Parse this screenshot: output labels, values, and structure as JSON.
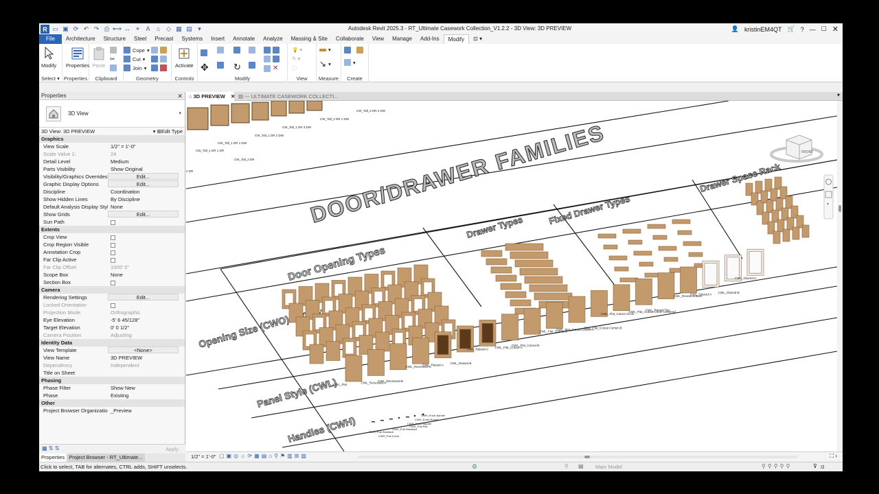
{
  "window": {
    "title": "Autodesk Revit 2025.3 - RT_Ultimate Casework Collection_V1.2.2 - 3D View: 3D PREVIEW",
    "user": "kristinEM4QT",
    "help": "?"
  },
  "ribbon_tabs": [
    "File",
    "Architecture",
    "Structure",
    "Steel",
    "Precast",
    "Systems",
    "Insert",
    "Annotate",
    "Analyze",
    "Massing & Site",
    "Collaborate",
    "View",
    "Manage",
    "Add-Ins",
    "Modify"
  ],
  "ribbon": {
    "select": {
      "modify": "Modify",
      "label": "Select"
    },
    "properties": {
      "button": "Properties",
      "label": "Properties"
    },
    "clipboard": {
      "paste": "Paste",
      "cope": "Cope",
      "cut": "Cut",
      "join": "Join",
      "label": "Clipboard"
    },
    "geometry": {
      "label": "Geometry"
    },
    "controls": {
      "activate": "Activate",
      "label": "Controls"
    },
    "modify": {
      "label": "Modify"
    },
    "view": {
      "label": "View"
    },
    "measure": {
      "label": "Measure"
    },
    "create": {
      "label": "Create"
    }
  },
  "properties": {
    "header": "Properties",
    "type_name": "3D View",
    "instance": "3D View: 3D PREVIEW",
    "edit_type": "Edit Type",
    "apply": "Apply",
    "groups": [
      {
        "name": "Graphics",
        "rows": [
          {
            "n": "View Scale",
            "v": "1/2\" = 1'-0\""
          },
          {
            "n": "Scale Value    1:",
            "v": "24",
            "dim": true
          },
          {
            "n": "Detail Level",
            "v": "Medium"
          },
          {
            "n": "Parts Visibility",
            "v": "Show Original"
          },
          {
            "n": "Visibility/Graphics Overrides",
            "v": "Edit...",
            "btn": true
          },
          {
            "n": "Graphic Display Options",
            "v": "Edit...",
            "btn": true
          },
          {
            "n": "Discipline",
            "v": "Coordination"
          },
          {
            "n": "Show Hidden Lines",
            "v": "By Discipline"
          },
          {
            "n": "Default Analysis Display Style",
            "v": "None"
          },
          {
            "n": "Show Grids",
            "v": "Edit...",
            "btn": true
          },
          {
            "n": "Sun Path",
            "v": "",
            "cb": true
          }
        ]
      },
      {
        "name": "Extents",
        "rows": [
          {
            "n": "Crop View",
            "v": "",
            "cb": true
          },
          {
            "n": "Crop Region Visible",
            "v": "",
            "cb": true
          },
          {
            "n": "Annotation Crop",
            "v": "",
            "cb": true
          },
          {
            "n": "Far Clip Active",
            "v": "",
            "cb": true
          },
          {
            "n": "Far Clip Offset",
            "v": "1000'  0\"",
            "dim": true
          },
          {
            "n": "Scope Box",
            "v": "None"
          },
          {
            "n": "Section Box",
            "v": "",
            "cb": true
          }
        ]
      },
      {
        "name": "Camera",
        "rows": [
          {
            "n": "Rendering Settings",
            "v": "Edit...",
            "btn": true
          },
          {
            "n": "Locked Orientation",
            "v": "",
            "cb": true,
            "dim": true
          },
          {
            "n": "Projection Mode",
            "v": "Orthographic",
            "dim": true
          },
          {
            "n": "Eye Elevation",
            "v": "-5'  6 45/128\""
          },
          {
            "n": "Target Elevation",
            "v": "0'  0 1/2\""
          },
          {
            "n": "Camera Position",
            "v": "Adjusting",
            "dim": true
          }
        ]
      },
      {
        "name": "Identity Data",
        "rows": [
          {
            "n": "View Template",
            "v": "<None>",
            "btn": true
          },
          {
            "n": "View Name",
            "v": "3D PREVIEW"
          },
          {
            "n": "Dependency",
            "v": "Independent",
            "dim": true
          },
          {
            "n": "Title on Sheet",
            "v": ""
          }
        ]
      },
      {
        "name": "Phasing",
        "rows": [
          {
            "n": "Phase Filter",
            "v": "Show New"
          },
          {
            "n": "Phase",
            "v": "Existing"
          }
        ]
      },
      {
        "name": "Other",
        "rows": [
          {
            "n": "Project Browser Organization",
            "v": "_Preview"
          }
        ]
      }
    ],
    "tabs": [
      "Properties",
      "Project Browser - RT_Ultimate..."
    ]
  },
  "view_tabs": [
    {
      "label": "3D PREVIEW",
      "active": true
    },
    {
      "label": "--- ULTIMATE CASEWORK COLLECTI...",
      "active": false
    }
  ],
  "viewport": {
    "heading": "DOOR/DRAWER FAMILIES",
    "sections": [
      "Door Opening Types",
      "Drawer Types",
      "Fixed Drawer Types",
      "Drawer Space Rack",
      "Opening Size (CWO) Type 1-5",
      "Panel Style (CWL)",
      "Handles (CWH)"
    ],
    "tall_labels": [
      "CW_Tall_1 DR 1 DR",
      "CW_Tall_1 DR 1 DW",
      "CW_Tall_1 DR 2 DW",
      "CW_Tall_1 DR 3 DW",
      "CW_Tall_2 DR 1 DW",
      "CW_Tall_2 DR 2 DW",
      "CW_Tall_2 DR",
      "2 DR"
    ],
    "panel_labels": [
      "CWL_Flat",
      "CWL_Recessed-A",
      "CWL_Recessed-B",
      "CWL_Recessed-C",
      "CWL_Raised-A",
      "CWL_Raised-B",
      "CWL_Raised-C",
      "CWL_Flat_Cutout-A",
      "CWL_Flat_Cutout-B",
      "CWL_Flat_Cutout-C",
      "CWL_Flat_Cutout Center-A",
      "CWL_Flat_Cutout Center-B",
      "CWL_Flat_Cutout Circle",
      "CWL_Flat_Cutout Circle Centered",
      "CWL_Reveal Top",
      "CWL_Reveal Bottom",
      "CWL_Glazed-A",
      "CWL_Glazed-B",
      "CWL_Glazed-C"
    ],
    "handle_labels": [
      "CWH_Pull-Standard",
      "CWH_Pull-Curve",
      "CWH_Pull-Standard",
      "CWH_Knob-Square",
      "CWH_Pull-Flat",
      "CWH_Knob-Round",
      "CWH_Knob-Sphere"
    ],
    "cube_label": "FRONT"
  },
  "viewbar": {
    "scale": "1/2\" = 1'-0\""
  },
  "status": {
    "text": "Click to select, TAB for alternates, CTRL adds, SHIFT unselects.",
    "model": "Main Model",
    "count": ":0"
  },
  "colors": {
    "file_tab": "#2a66b8",
    "wood": "#c39a6b",
    "wood_dark": "#8a6238"
  }
}
